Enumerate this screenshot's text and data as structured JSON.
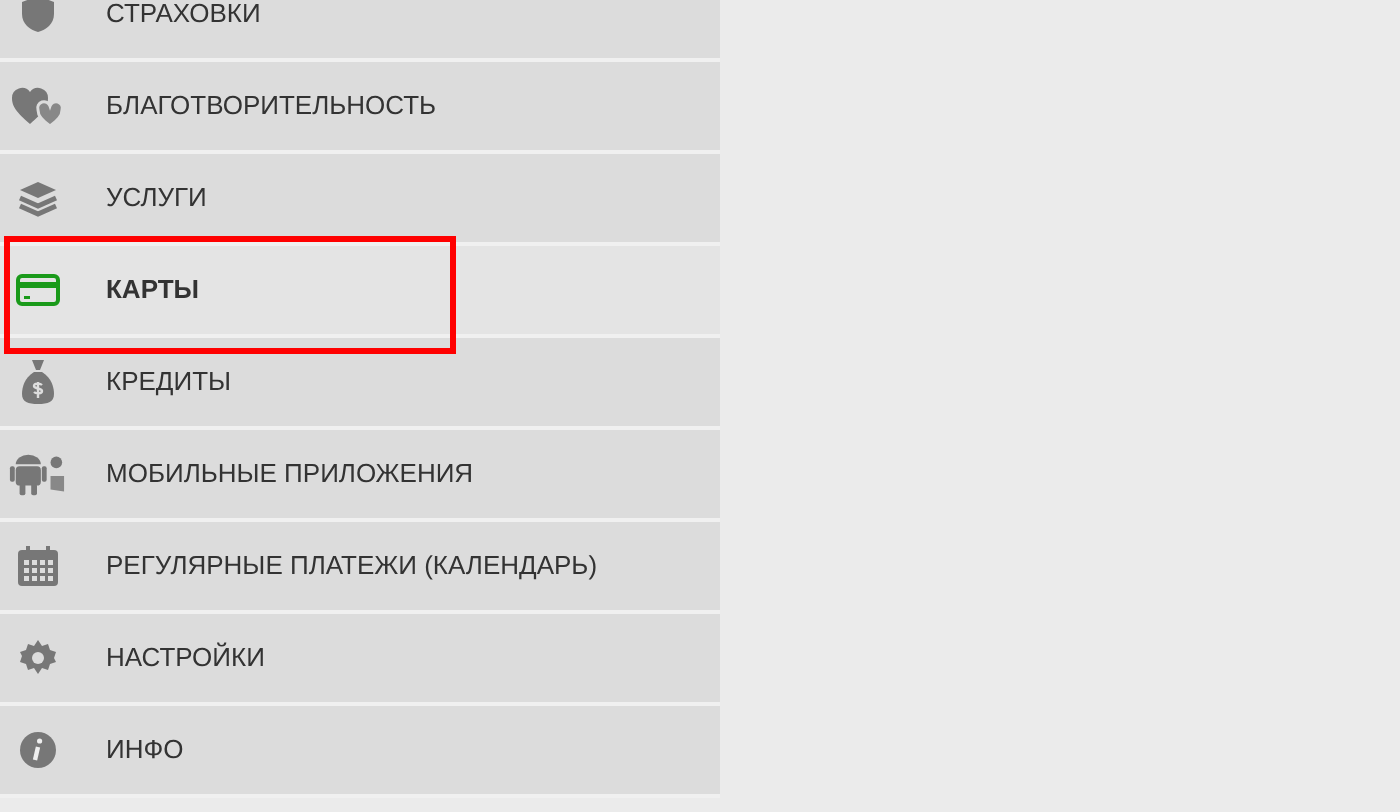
{
  "menu": {
    "items": [
      {
        "kind": "shield",
        "label": "СТРАХОВКИ",
        "selected": false,
        "outlined": false
      },
      {
        "kind": "hearts",
        "label": "БЛАГОТВОРИТЕЛЬНОСТЬ",
        "selected": false,
        "outlined": false
      },
      {
        "kind": "layers",
        "label": "УСЛУГИ",
        "selected": false,
        "outlined": false
      },
      {
        "kind": "card",
        "label": "КАРТЫ",
        "selected": true,
        "outlined": true
      },
      {
        "kind": "moneybag",
        "label": "КРЕДИТЫ",
        "selected": false,
        "outlined": false
      },
      {
        "kind": "mobile",
        "label": "МОБИЛЬНЫЕ ПРИЛОЖЕНИЯ",
        "selected": false,
        "outlined": false
      },
      {
        "kind": "calendar",
        "label": "РЕГУЛЯРНЫЕ ПЛАТЕЖИ (КАЛЕНДАРЬ)",
        "selected": false,
        "outlined": false
      },
      {
        "kind": "gear",
        "label": "НАСТРОЙКИ",
        "selected": false,
        "outlined": false
      },
      {
        "kind": "info",
        "label": "ИНФО",
        "selected": false,
        "outlined": false
      }
    ]
  }
}
